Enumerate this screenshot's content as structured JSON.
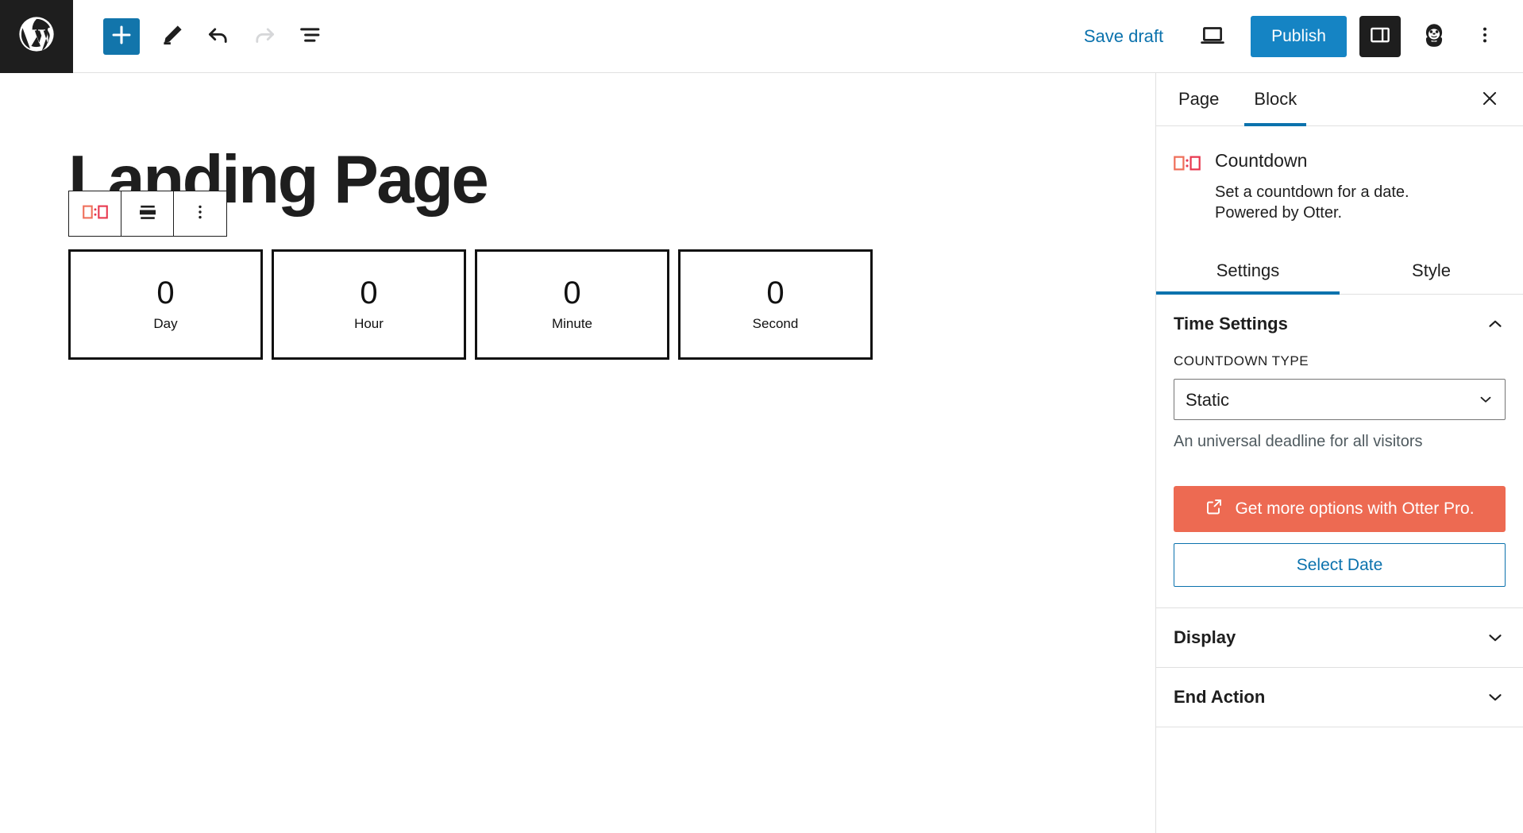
{
  "topbar": {
    "logo_icon": "wordpress-logo-icon",
    "add_block_label": "+",
    "tools": [
      {
        "name": "add-block-button",
        "icon": "plus-icon"
      },
      {
        "name": "edit-tool-button",
        "icon": "pencil-icon"
      },
      {
        "name": "undo-button",
        "icon": "undo-arrow-icon"
      },
      {
        "name": "redo-button",
        "icon": "redo-arrow-icon"
      },
      {
        "name": "document-overview-button",
        "icon": "list-view-icon"
      }
    ],
    "save_draft_label": "Save draft",
    "preview_icon": "desktop-preview-icon",
    "publish_label": "Publish",
    "sidebar_toggle_icon": "settings-sidebar-icon",
    "otter_icon": "otter-mascot-icon",
    "more_icon": "kebab-menu-icon"
  },
  "canvas": {
    "page_title": "Landing Page",
    "block_toolbar": [
      {
        "name": "block-type-countdown-button",
        "icon": "countdown-icon"
      },
      {
        "name": "align-button",
        "icon": "align-center-icon"
      },
      {
        "name": "block-options-button",
        "icon": "kebab-menu-icon"
      }
    ],
    "countdown": [
      {
        "value": "0",
        "label": "Day"
      },
      {
        "value": "0",
        "label": "Hour"
      },
      {
        "value": "0",
        "label": "Minute"
      },
      {
        "value": "0",
        "label": "Second"
      }
    ]
  },
  "sidebar": {
    "tabs": [
      {
        "label": "Page",
        "active": false
      },
      {
        "label": "Block",
        "active": true
      }
    ],
    "close_icon": "close-icon",
    "block": {
      "icon": "countdown-icon",
      "title": "Countdown",
      "description": "Set a countdown for a date. Powered by Otter."
    },
    "subtabs": [
      {
        "label": "Settings",
        "active": true
      },
      {
        "label": "Style",
        "active": false
      }
    ],
    "panels": [
      {
        "title": "Time Settings",
        "expanded": true,
        "chevron": "chevron-up-icon",
        "field_label": "COUNTDOWN TYPE",
        "select_value": "Static",
        "select_options": [
          "Static"
        ],
        "select_chevron": "chevron-down-icon",
        "help_text": "An universal deadline for all visitors",
        "pro_button_label": "Get more options with Otter Pro.",
        "pro_button_icon": "external-link-icon",
        "date_button_label": "Select Date"
      },
      {
        "title": "Display",
        "expanded": false,
        "chevron": "chevron-down-icon"
      },
      {
        "title": "End Action",
        "expanded": false,
        "chevron": "chevron-down-icon"
      }
    ]
  },
  "colors": {
    "wp_blue": "#0b72ad",
    "publish_blue": "#1584c4",
    "otter_orange": "#ed6a52",
    "countdown_icon_red": "#e8384f",
    "dark": "#1e1e1e"
  }
}
